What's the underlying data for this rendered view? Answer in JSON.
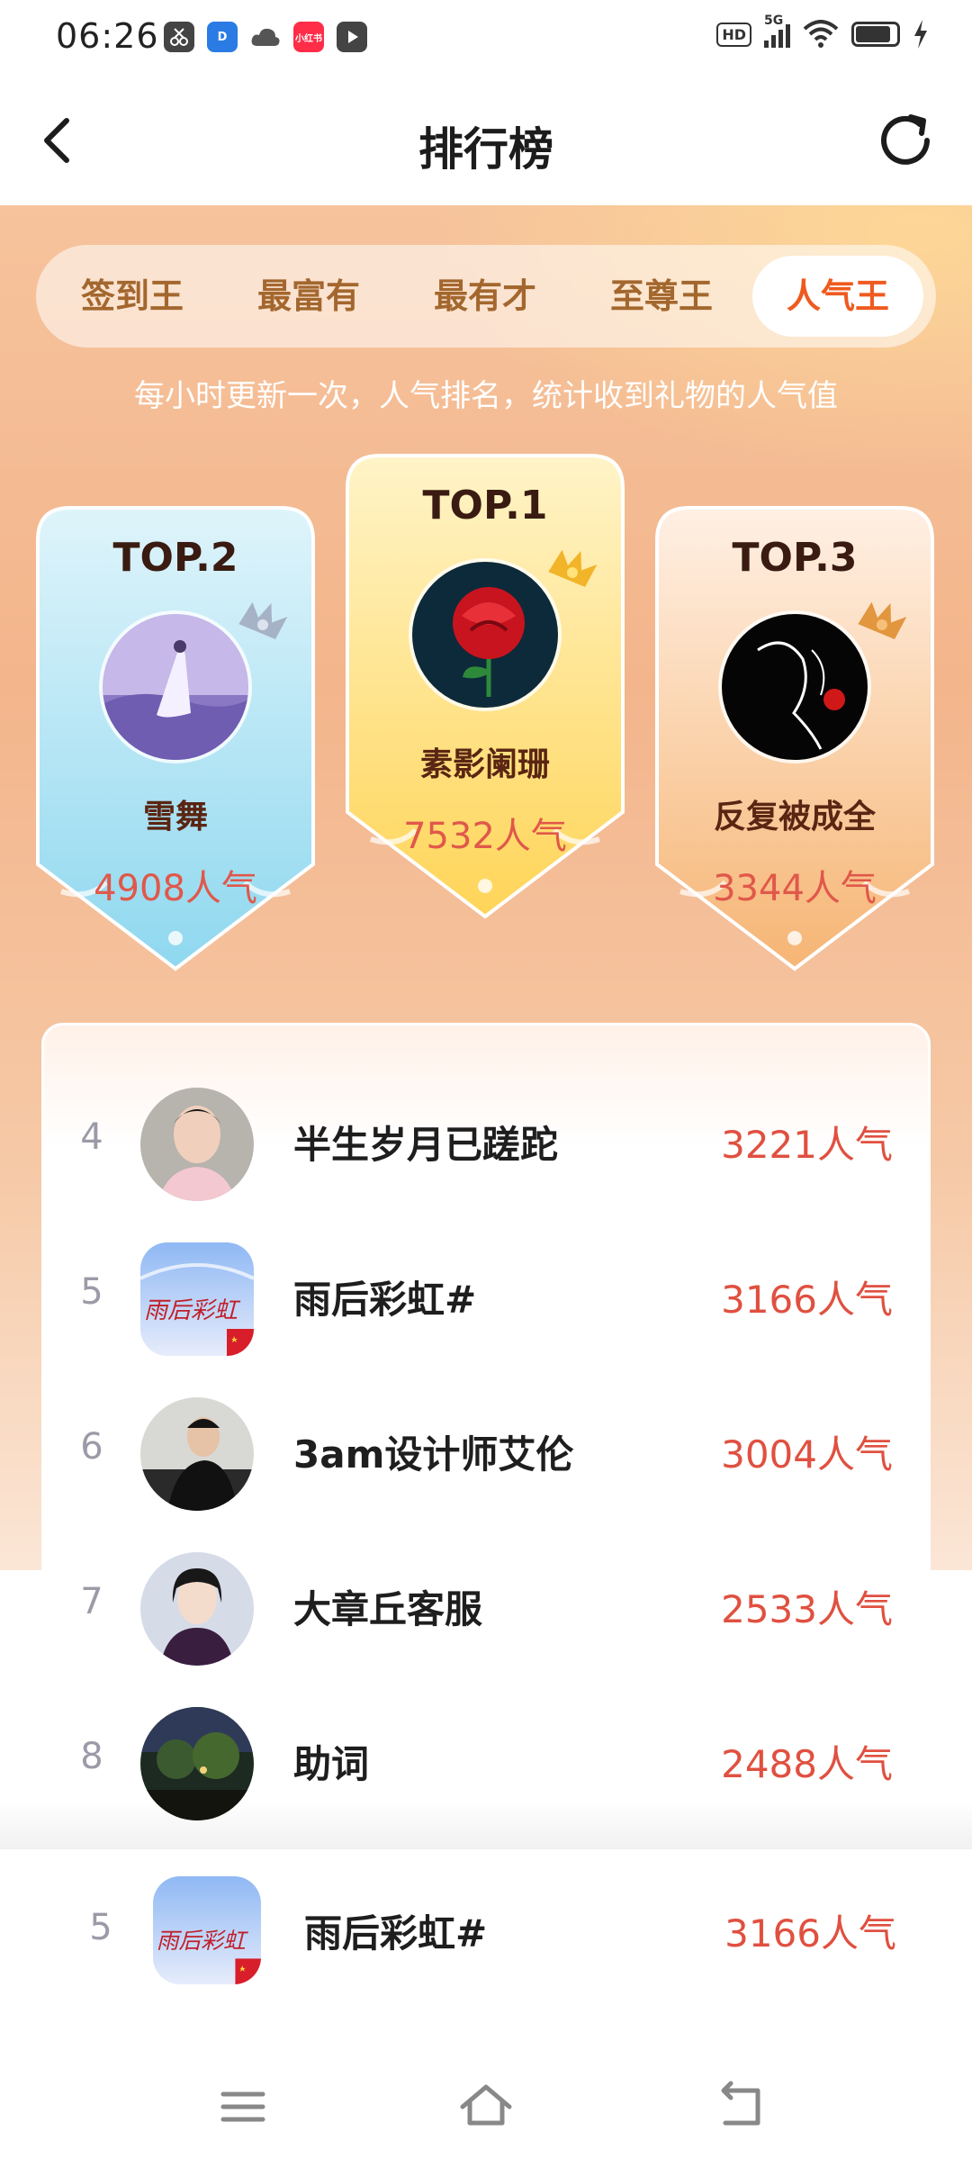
{
  "status_bar": {
    "time": "06:26",
    "app_icons": [
      {
        "icon": "scissors-app-icon",
        "color": "#444444",
        "text": ""
      },
      {
        "icon": "d-app-icon",
        "color": "#2a7be4",
        "text": "D"
      },
      {
        "icon": "cloud-icon",
        "color": "#555555",
        "text": ""
      },
      {
        "icon": "xiaohongshu-icon",
        "color": "#ff2d48",
        "text": "小红书"
      },
      {
        "icon": "play-app-icon",
        "color": "#444444",
        "text": ""
      }
    ],
    "hd_label": "HD",
    "network": "5G"
  },
  "header": {
    "title": "排行榜"
  },
  "tabs": [
    {
      "label": "签到王",
      "active": false
    },
    {
      "label": "最富有",
      "active": false
    },
    {
      "label": "最有才",
      "active": false
    },
    {
      "label": "至尊王",
      "active": false
    },
    {
      "label": "人气王",
      "active": true
    }
  ],
  "subtitle": "每小时更新一次，人气排名，统计收到礼物的人气值",
  "top3": {
    "first": {
      "label": "TOP.1",
      "name": "素影阑珊",
      "score": "7532人气",
      "avatar": "red-rose"
    },
    "second": {
      "label": "TOP.2",
      "name": "雪舞",
      "score": "4908人气",
      "avatar": "purple-field"
    },
    "third": {
      "label": "TOP.3",
      "name": "反复被成全",
      "score": "3344人气",
      "avatar": "silhouette-rose"
    }
  },
  "ranking": [
    {
      "rank": "4",
      "name": "半生岁月已蹉跎",
      "score": "3221人气",
      "avatar": "man-portrait"
    },
    {
      "rank": "5",
      "name": "雨后彩虹#",
      "score": "3166人气",
      "avatar": "rainbow-text"
    },
    {
      "rank": "6",
      "name": "3am设计师艾伦",
      "score": "3004人气",
      "avatar": "man-suit"
    },
    {
      "rank": "7",
      "name": "大章丘客服",
      "score": "2533人气",
      "avatar": "woman-portrait"
    },
    {
      "rank": "8",
      "name": "助词",
      "score": "2488人气",
      "avatar": "night-scene"
    }
  ],
  "my_rank": {
    "rank": "5",
    "name": "雨后彩虹#",
    "score": "3166人气"
  },
  "avatar_text": {
    "rainbow": "雨后彩虹"
  },
  "colors": {
    "accent": "#ef5a1f",
    "score": "#e05040",
    "tab_text": "#a3672e"
  }
}
